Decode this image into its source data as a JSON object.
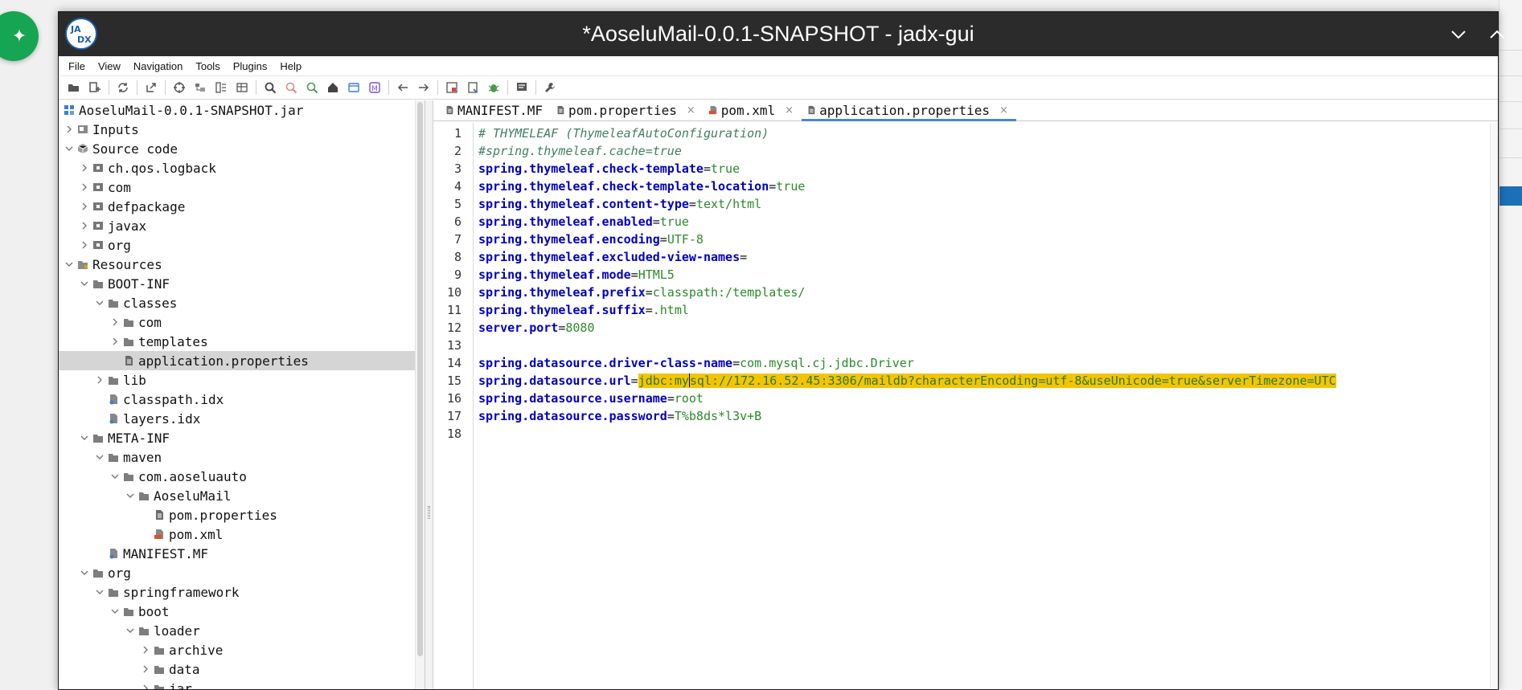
{
  "window": {
    "title": "*AoseluMail-0.0.1-SNAPSHOT - jadx-gui"
  },
  "menu": [
    "File",
    "View",
    "Navigation",
    "Tools",
    "Plugins",
    "Help"
  ],
  "toolbar": [
    {
      "icon": "open-folder-icon"
    },
    {
      "icon": "add-files-icon"
    },
    {
      "sep": true
    },
    {
      "icon": "sync-icon"
    },
    {
      "sep": true
    },
    {
      "icon": "export-icon"
    },
    {
      "sep": true
    },
    {
      "icon": "target-icon"
    },
    {
      "icon": "flatten-packages-icon"
    },
    {
      "icon": "split-view-icon"
    },
    {
      "icon": "table-view-icon"
    },
    {
      "sep": true
    },
    {
      "icon": "search-icon"
    },
    {
      "icon": "find-class-icon"
    },
    {
      "icon": "find-usage-icon"
    },
    {
      "icon": "home-icon"
    },
    {
      "icon": "window-icon"
    },
    {
      "icon": "method-icon"
    },
    {
      "sep": true
    },
    {
      "icon": "arrow-left-icon"
    },
    {
      "icon": "arrow-right-icon"
    },
    {
      "sep": true
    },
    {
      "icon": "deobfuscation-icon"
    },
    {
      "icon": "log-icon"
    },
    {
      "icon": "bug-icon"
    },
    {
      "sep": true
    },
    {
      "icon": "comment-icon"
    },
    {
      "sep": true
    },
    {
      "icon": "wrench-icon"
    }
  ],
  "tree": [
    {
      "label": "AoseluMail-0.0.1-SNAPSHOT.jar",
      "depth": 0,
      "chevron": "none",
      "icon": "jar-icon"
    },
    {
      "label": "Inputs",
      "depth": 0,
      "chevron": "right",
      "icon": "inputs-icon"
    },
    {
      "label": "Source code",
      "depth": 0,
      "chevron": "down",
      "icon": "source-icon"
    },
    {
      "label": "ch.qos.logback",
      "depth": 1,
      "chevron": "right",
      "icon": "package-icon"
    },
    {
      "label": "com",
      "depth": 1,
      "chevron": "right",
      "icon": "package-icon"
    },
    {
      "label": "defpackage",
      "depth": 1,
      "chevron": "right",
      "icon": "package-icon"
    },
    {
      "label": "javax",
      "depth": 1,
      "chevron": "right",
      "icon": "package-icon"
    },
    {
      "label": "org",
      "depth": 1,
      "chevron": "right",
      "icon": "package-icon"
    },
    {
      "label": "Resources",
      "depth": 0,
      "chevron": "down",
      "icon": "resources-icon"
    },
    {
      "label": "BOOT-INF",
      "depth": 1,
      "chevron": "down",
      "icon": "folder-icon"
    },
    {
      "label": "classes",
      "depth": 2,
      "chevron": "down",
      "icon": "folder-icon"
    },
    {
      "label": "com",
      "depth": 3,
      "chevron": "right",
      "icon": "folder-icon"
    },
    {
      "label": "templates",
      "depth": 3,
      "chevron": "right",
      "icon": "folder-icon"
    },
    {
      "label": "application.properties",
      "depth": 3,
      "chevron": "none",
      "icon": "file-icon",
      "selected": true
    },
    {
      "label": "lib",
      "depth": 2,
      "chevron": "right",
      "icon": "folder-icon"
    },
    {
      "label": "classpath.idx",
      "depth": 2,
      "chevron": "none",
      "icon": "resource-file-icon"
    },
    {
      "label": "layers.idx",
      "depth": 2,
      "chevron": "none",
      "icon": "resource-file-icon"
    },
    {
      "label": "META-INF",
      "depth": 1,
      "chevron": "down",
      "icon": "folder-icon"
    },
    {
      "label": "maven",
      "depth": 2,
      "chevron": "down",
      "icon": "folder-icon"
    },
    {
      "label": "com.aoseluauto",
      "depth": 3,
      "chevron": "down",
      "icon": "folder-icon"
    },
    {
      "label": "AoseluMail",
      "depth": 4,
      "chevron": "down",
      "icon": "folder-icon"
    },
    {
      "label": "pom.properties",
      "depth": 5,
      "chevron": "none",
      "icon": "file-icon"
    },
    {
      "label": "pom.xml",
      "depth": 5,
      "chevron": "none",
      "icon": "xml-file-icon"
    },
    {
      "label": "MANIFEST.MF",
      "depth": 2,
      "chevron": "none",
      "icon": "resource-file-icon"
    },
    {
      "label": "org",
      "depth": 1,
      "chevron": "down",
      "icon": "folder-icon"
    },
    {
      "label": "springframework",
      "depth": 2,
      "chevron": "down",
      "icon": "folder-icon"
    },
    {
      "label": "boot",
      "depth": 3,
      "chevron": "down",
      "icon": "folder-icon"
    },
    {
      "label": "loader",
      "depth": 4,
      "chevron": "down",
      "icon": "folder-icon"
    },
    {
      "label": "archive",
      "depth": 5,
      "chevron": "right",
      "icon": "folder-icon"
    },
    {
      "label": "data",
      "depth": 5,
      "chevron": "right",
      "icon": "folder-icon"
    },
    {
      "label": "jar",
      "depth": 5,
      "chevron": "right",
      "icon": "folder-icon"
    }
  ],
  "tabs": [
    {
      "label": "MANIFEST.MF",
      "icon": "file-icon",
      "closable": false,
      "active": false
    },
    {
      "label": "pom.properties",
      "icon": "file-icon",
      "closable": true,
      "active": false
    },
    {
      "label": "pom.xml",
      "icon": "xml-file-icon",
      "closable": true,
      "active": false
    },
    {
      "label": "application.properties",
      "icon": "file-icon",
      "closable": true,
      "active": true
    }
  ],
  "close_glyph": "×",
  "code": [
    {
      "type": "comment",
      "text": "# THYMELEAF (ThymeleafAutoConfiguration)"
    },
    {
      "type": "comment",
      "text": "#spring.thymeleaf.cache=true"
    },
    {
      "type": "prop",
      "key": "spring.thymeleaf.check-template",
      "value": "true"
    },
    {
      "type": "prop",
      "key": "spring.thymeleaf.check-template-location",
      "value": "true"
    },
    {
      "type": "prop",
      "key": "spring.thymeleaf.content-type",
      "value": "text/html"
    },
    {
      "type": "prop",
      "key": "spring.thymeleaf.enabled",
      "value": "true"
    },
    {
      "type": "prop",
      "key": "spring.thymeleaf.encoding",
      "value": "UTF-8"
    },
    {
      "type": "prop",
      "key": "spring.thymeleaf.excluded-view-names",
      "value": ""
    },
    {
      "type": "prop",
      "key": "spring.thymeleaf.mode",
      "value": "HTML5"
    },
    {
      "type": "prop",
      "key": "spring.thymeleaf.prefix",
      "value": "classpath:/templates/"
    },
    {
      "type": "prop",
      "key": "spring.thymeleaf.suffix",
      "value": ".html"
    },
    {
      "type": "prop",
      "key": "server.port",
      "value": "8080"
    },
    {
      "type": "empty"
    },
    {
      "type": "prop",
      "key": "spring.datasource.driver-class-name",
      "value": "com.mysql.cj.jdbc.Driver"
    },
    {
      "type": "prop",
      "key": "spring.datasource.url",
      "value_before_caret": "jdbc:my",
      "value_after_caret": "sql://172.16.52.45:3306/maildb?characterEncoding=utf-8&useUnicode=true&serverTimezone=UTC",
      "highlight": true
    },
    {
      "type": "prop",
      "key": "spring.datasource.username",
      "value": "root"
    },
    {
      "type": "prop",
      "key": "spring.datasource.password",
      "value": "T%b8ds*l3v+B"
    },
    {
      "type": "empty"
    }
  ],
  "colors": {
    "titlebar": "#2b2b2b",
    "key": "#0000c0",
    "value": "#2a8a2a",
    "comment": "#3f7f5f",
    "highlight": "#f5c400",
    "selection": "#d5d5d5",
    "tab_underline": "#4a88c7",
    "fab": "#16a552"
  }
}
